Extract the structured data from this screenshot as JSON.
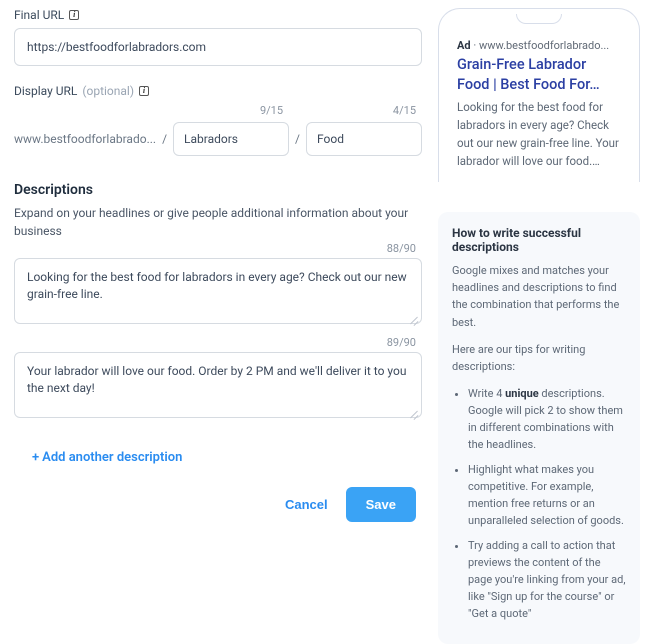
{
  "finalUrl": {
    "label": "Final URL",
    "value": "https://bestfoodforlabradors.com"
  },
  "displayUrl": {
    "label": "Display URL",
    "optional": "(optional)",
    "base": "www.bestfoodforlabrado...",
    "path1": {
      "value": "Labradors",
      "counter": "9/15"
    },
    "path2": {
      "value": "Food",
      "counter": "4/15"
    }
  },
  "descriptions": {
    "title": "Descriptions",
    "subtitle": "Expand on your headlines or give people additional information about your business",
    "items": [
      {
        "value": "Looking for the best food for labradors in every age? Check out our new grain-free line.",
        "counter": "88/90"
      },
      {
        "value": "Your labrador will love our food. Order by 2 PM and we'll deliver it to you the next day!",
        "counter": "89/90"
      }
    ],
    "addLabel": "Add another description"
  },
  "actions": {
    "cancel": "Cancel",
    "save": "Save"
  },
  "preview": {
    "adTag": "Ad",
    "dot": "·",
    "domain": "www.bestfoodforlabrado...",
    "title": "Grain-Free Labrador Food | Best Food For…",
    "desc": "Looking for the best food for labradors in every age? Check out our new grain-free line. Your labrador will love our food.…"
  },
  "tips": {
    "title": "How to write successful descriptions",
    "intro": "Google mixes and matches your headlines and descriptions to find the combination that performs the best.",
    "lead": "Here are our tips for writing descriptions:",
    "items": [
      {
        "pre": "Write 4 ",
        "bold": "unique",
        "post": " descriptions. Google will pick 2 to show them in different combinations with the headlines."
      },
      {
        "pre": "Highlight what makes you competitive. For example, mention free returns or an unparalleled selection of goods.",
        "bold": "",
        "post": ""
      },
      {
        "pre": "Try adding a call to action that previews the content of the page you're linking from your ad, like \"Sign up for the course\" or \"Get a quote\"",
        "bold": "",
        "post": ""
      }
    ]
  }
}
